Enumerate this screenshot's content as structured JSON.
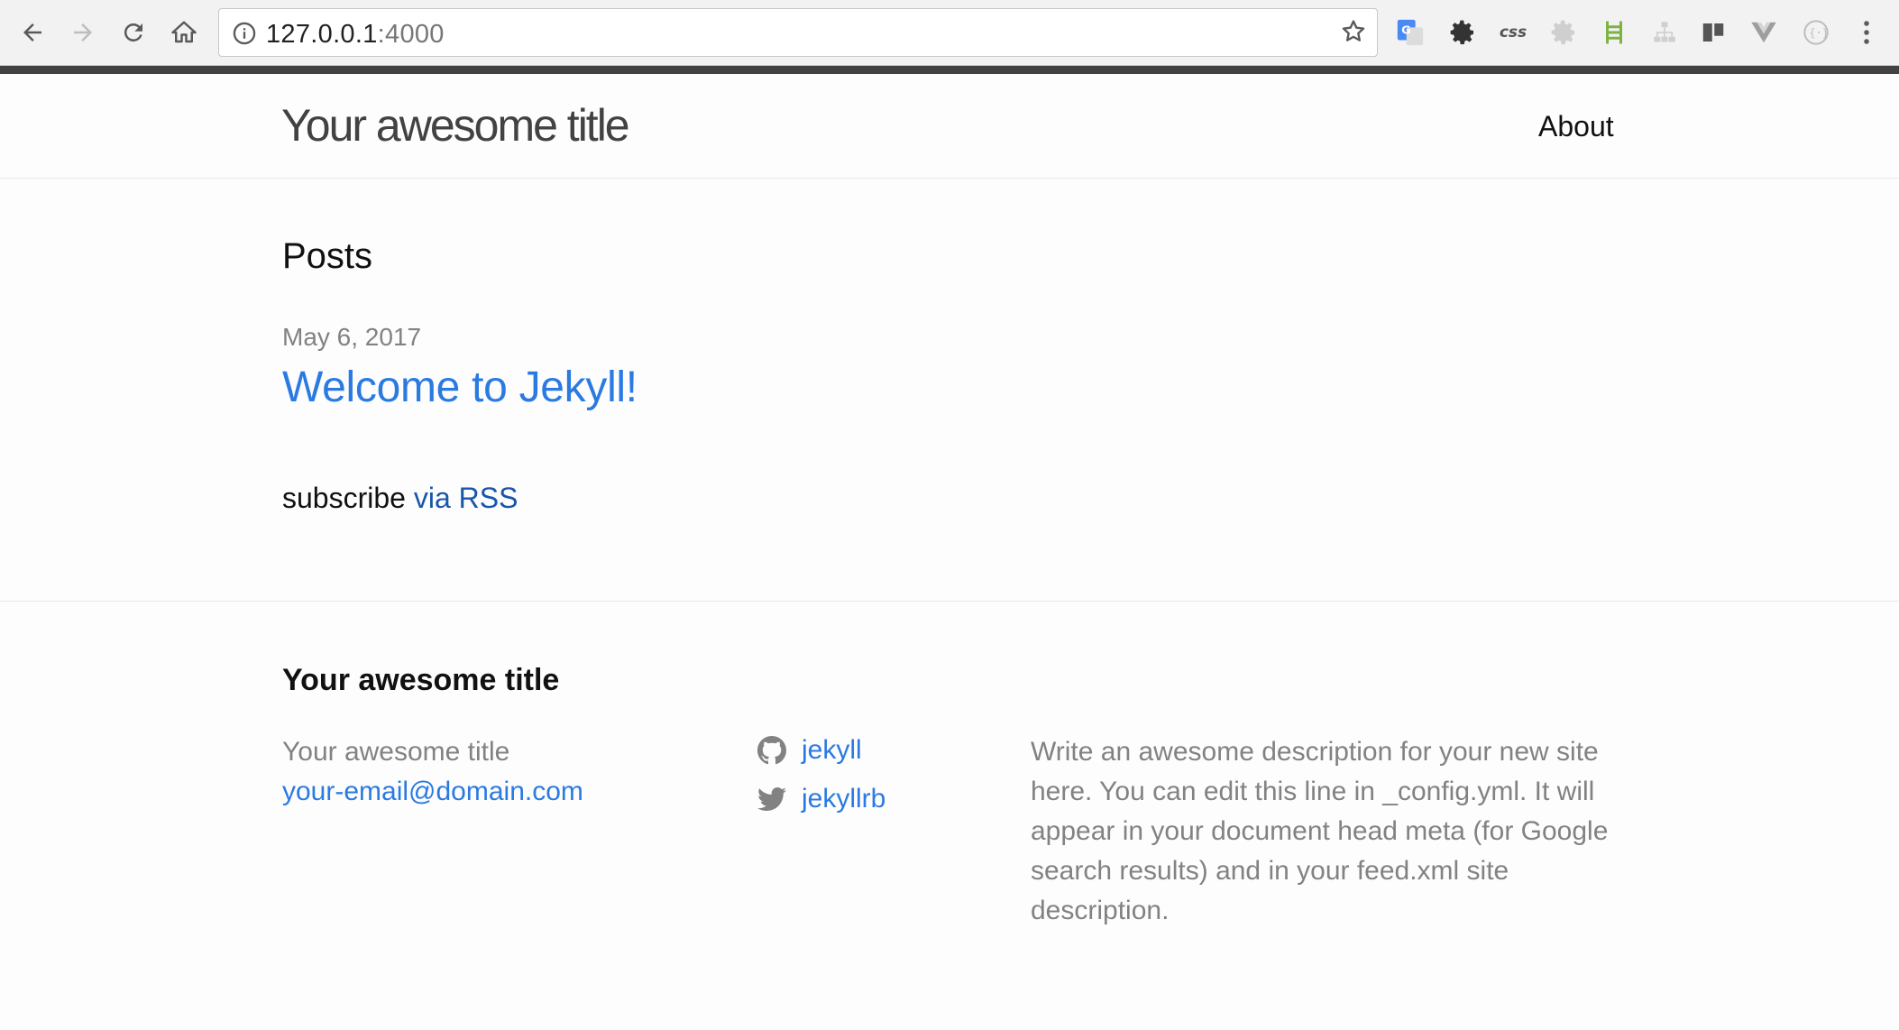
{
  "browser": {
    "url_host": "127.0.0.1",
    "url_port": ":4000",
    "icons": {
      "back": "back-arrow-icon",
      "forward": "forward-arrow-icon",
      "reload": "reload-icon",
      "home": "home-icon",
      "info": "info-icon",
      "bookmark": "star-icon",
      "menu": "kebab-menu-icon"
    },
    "extensions": {
      "css_label": "css"
    }
  },
  "header": {
    "site_title": "Your awesome title",
    "nav_about": "About"
  },
  "main": {
    "posts_heading": "Posts",
    "post": {
      "date": "May 6, 2017",
      "title": "Welcome to Jekyll!"
    },
    "subscribe_text": "subscribe",
    "rss_link": "via RSS"
  },
  "footer": {
    "heading": "Your awesome title",
    "name": "Your awesome title",
    "email": "your-email@domain.com",
    "github_username": "jekyll",
    "twitter_username": "jekyllrb",
    "description": "Write an awesome description for your new site here. You can edit this line in _config.yml. It will appear in your document head meta (for Google search results) and in your feed.xml site description."
  },
  "colors": {
    "link": "#2a7ae2",
    "rss_link": "#1756a9",
    "muted": "#828282",
    "top_bar": "#424242"
  }
}
